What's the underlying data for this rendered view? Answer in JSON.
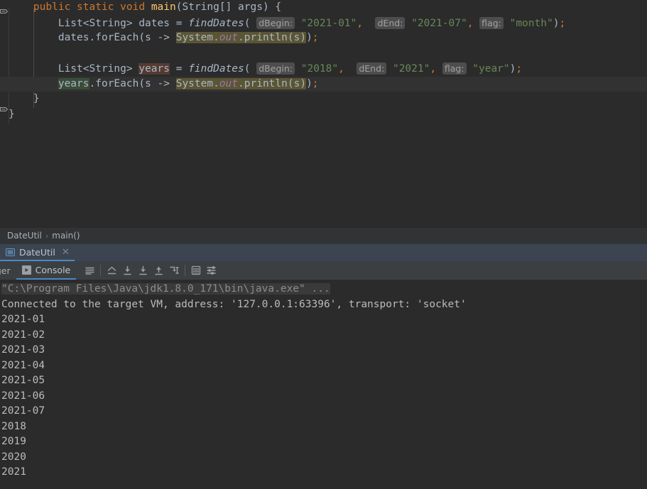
{
  "window": {
    "title": "IntelliJ IDEA - DateUtil",
    "theme": "Darcula",
    "colors": {
      "editor_bg": "#2b2b2b",
      "panel_bg": "#3c3f41",
      "breadcrumb_bg": "#313335",
      "runtab_bg": "#3c4452",
      "accent": "#4a88c7",
      "text": "#a9b7c6",
      "keyword": "#cc7832",
      "string": "#6a8759",
      "number": "#6897bb",
      "method": "#ffc66d",
      "field": "#9876aa",
      "hint_chip_bg": "#4d4d4d",
      "sysout_highlight": "#5b5534",
      "read_usage_highlight": "#3a4d3a",
      "write_usage_highlight": "#553a33"
    }
  },
  "editor": {
    "language": "Java",
    "lines": [
      {
        "n": 1,
        "indent": 4,
        "tokens": [
          {
            "t": "public",
            "c": "kw"
          },
          {
            "t": " ",
            "c": "txt"
          },
          {
            "t": "static",
            "c": "kw"
          },
          {
            "t": " ",
            "c": "txt"
          },
          {
            "t": "void",
            "c": "kw"
          },
          {
            "t": " ",
            "c": "txt"
          },
          {
            "t": "main",
            "c": "fn"
          },
          {
            "t": "(String[] args) {",
            "c": "txt"
          }
        ]
      },
      {
        "n": 2,
        "indent": 8,
        "tokens": [
          {
            "t": "List<String> dates = ",
            "c": "txt"
          },
          {
            "t": "findDates",
            "c": "mth"
          },
          {
            "t": "(",
            "c": "txt"
          },
          {
            "t": " ",
            "c": "txt"
          },
          {
            "t": "dBegin:",
            "c": "hint"
          },
          {
            "t": " ",
            "c": "txt"
          },
          {
            "t": "\"2021-01\"",
            "c": "str"
          },
          {
            "t": ",",
            "c": "comma"
          },
          {
            "t": "  ",
            "c": "txt"
          },
          {
            "t": "dEnd:",
            "c": "hint"
          },
          {
            "t": " ",
            "c": "txt"
          },
          {
            "t": "\"2021-07\"",
            "c": "str"
          },
          {
            "t": ",",
            "c": "comma"
          },
          {
            "t": " ",
            "c": "txt"
          },
          {
            "t": "flag:",
            "c": "hint"
          },
          {
            "t": " ",
            "c": "txt"
          },
          {
            "t": "\"month\"",
            "c": "str"
          },
          {
            "t": ")",
            "c": "txt"
          },
          {
            "t": ";",
            "c": "semi"
          }
        ]
      },
      {
        "n": 3,
        "indent": 8,
        "tokens": [
          {
            "t": "dates",
            "c": "txt"
          },
          {
            "t": ".forEach(s -> ",
            "c": "txt"
          },
          {
            "t": "System.",
            "c": "sysout"
          },
          {
            "t": "out",
            "c": "sysout-field"
          },
          {
            "t": ".println(s)",
            "c": "sysout"
          },
          {
            "t": ")",
            "c": "txt"
          },
          {
            "t": ";",
            "c": "semi"
          }
        ]
      },
      {
        "n": 4,
        "indent": 0,
        "tokens": []
      },
      {
        "n": 5,
        "indent": 8,
        "tokens": [
          {
            "t": "List<String> ",
            "c": "txt"
          },
          {
            "t": "years",
            "c": "write"
          },
          {
            "t": " = ",
            "c": "txt"
          },
          {
            "t": "findDates",
            "c": "mth"
          },
          {
            "t": "(",
            "c": "txt"
          },
          {
            "t": " ",
            "c": "txt"
          },
          {
            "t": "dBegin:",
            "c": "hint"
          },
          {
            "t": " ",
            "c": "txt"
          },
          {
            "t": "\"2018\"",
            "c": "str"
          },
          {
            "t": ",",
            "c": "comma"
          },
          {
            "t": "  ",
            "c": "txt"
          },
          {
            "t": "dEnd:",
            "c": "hint"
          },
          {
            "t": " ",
            "c": "txt"
          },
          {
            "t": "\"2021\"",
            "c": "str"
          },
          {
            "t": ",",
            "c": "comma"
          },
          {
            "t": " ",
            "c": "txt"
          },
          {
            "t": "flag:",
            "c": "hint"
          },
          {
            "t": " ",
            "c": "txt"
          },
          {
            "t": "\"year\"",
            "c": "str"
          },
          {
            "t": ")",
            "c": "txt"
          },
          {
            "t": ";",
            "c": "semi"
          }
        ]
      },
      {
        "n": 6,
        "indent": 8,
        "current": true,
        "tokens": [
          {
            "t": "years",
            "c": "read"
          },
          {
            "t": ".forEach(s -> ",
            "c": "txt"
          },
          {
            "t": "System.",
            "c": "sysout"
          },
          {
            "t": "out",
            "c": "sysout-field"
          },
          {
            "t": ".println(s)",
            "c": "sysout"
          },
          {
            "t": ")",
            "c": "txt"
          },
          {
            "t": ";",
            "c": "semi"
          }
        ]
      },
      {
        "n": 7,
        "indent": 4,
        "tokens": [
          {
            "t": "}",
            "c": "txt"
          }
        ]
      },
      {
        "n": 8,
        "indent": 0,
        "tokens": [
          {
            "t": "}",
            "c": "txt"
          }
        ]
      }
    ]
  },
  "breadcrumb": {
    "items": [
      "DateUtil",
      "main()"
    ],
    "separator": "›"
  },
  "run_tab": {
    "label": "DateUtil",
    "close_label": "✕",
    "icon": "run-configuration-icon",
    "selected": true
  },
  "console_toolbar": {
    "tabs": [
      {
        "label": "ugger",
        "full_label": "Debugger",
        "active": false,
        "clipped": true
      },
      {
        "label": "Console",
        "active": true,
        "icon": "console-play-icon"
      }
    ],
    "buttons": [
      {
        "name": "soft-wrap-button",
        "icon": "lines-icon",
        "tooltip": "Use Soft Wraps"
      },
      {
        "name": "show-execution-point-button",
        "icon": "execution-point-icon",
        "tooltip": "Show Execution Point"
      },
      {
        "name": "step-over-button",
        "icon": "step-over-icon",
        "tooltip": "Step Over"
      },
      {
        "name": "step-into-button",
        "icon": "step-into-icon",
        "tooltip": "Step Into"
      },
      {
        "name": "step-out-button",
        "icon": "step-out-icon",
        "tooltip": "Step Out"
      },
      {
        "name": "run-to-cursor-button",
        "icon": "run-to-cursor-icon",
        "tooltip": "Run to Cursor"
      },
      {
        "name": "evaluate-expression-button",
        "icon": "calculator-icon",
        "tooltip": "Evaluate Expression"
      },
      {
        "name": "print-settings-button",
        "icon": "settings-sliders-icon",
        "tooltip": "Settings"
      }
    ]
  },
  "console_output": {
    "command_line": "\"C:\\Program Files\\Java\\jdk1.8.0_171\\bin\\java.exe\" ...",
    "lines": [
      "Connected to the target VM, address: '127.0.0.1:63396', transport: 'socket'",
      "2021-01",
      "2021-02",
      "2021-03",
      "2021-04",
      "2021-05",
      "2021-06",
      "2021-07",
      "2018",
      "2019",
      "2020",
      "2021"
    ]
  }
}
